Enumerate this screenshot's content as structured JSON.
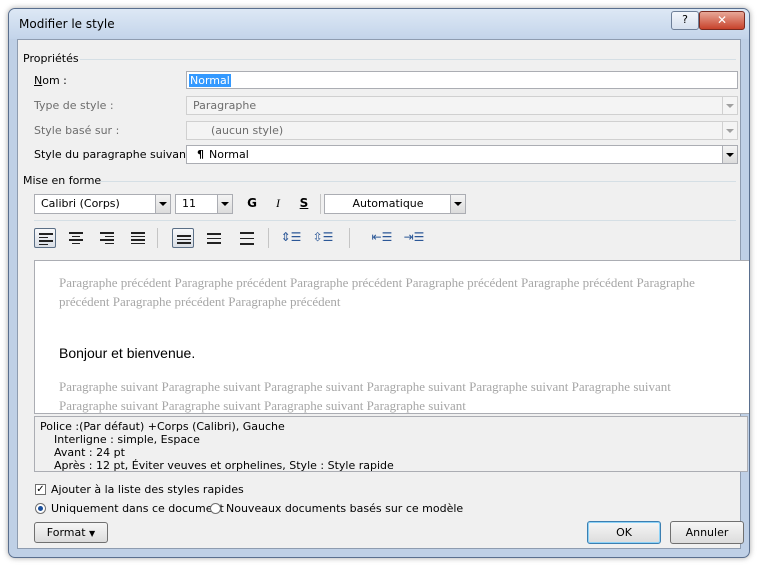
{
  "window": {
    "title": "Modifier le style",
    "help_label": "?",
    "close_label": "✕"
  },
  "properties": {
    "section_label": "Propriétés",
    "name_label": "Nom :",
    "name_value": "Normal",
    "style_type_label": "Type de style :",
    "style_type_value": "Paragraphe",
    "based_on_label": "Style basé sur :",
    "based_on_value": "(aucun style)",
    "next_style_label": "Style du paragraphe suivant :",
    "next_style_icon": "¶",
    "next_style_value": "Normal"
  },
  "formatting": {
    "section_label": "Mise en forme",
    "font": "Calibri (Corps)",
    "size": "11",
    "bold_label": "G",
    "italic_label": "I",
    "underline_label": "S",
    "color": "Automatique"
  },
  "preview": {
    "previous": "Paragraphe précédent Paragraphe précédent Paragraphe précédent Paragraphe précédent Paragraphe précédent Paragraphe précédent Paragraphe précédent Paragraphe précédent",
    "sample": "Bonjour et bienvenue.",
    "next": "Paragraphe suivant Paragraphe suivant Paragraphe suivant Paragraphe suivant Paragraphe suivant Paragraphe suivant Paragraphe suivant Paragraphe suivant Paragraphe suivant Paragraphe suivant"
  },
  "description": {
    "line1": "Police :(Par défaut) +Corps (Calibri), Gauche",
    "line2": "Interligne : simple, Espace",
    "line3": "Avant : 24 pt",
    "line4": "Après : 12 pt, Éviter veuves et orphelines, Style : Style rapide"
  },
  "options": {
    "add_quick_styles": "Ajouter à la liste des styles rapides",
    "only_this_document": "Uniquement dans ce document",
    "new_documents": "Nouveaux documents basés sur ce modèle"
  },
  "buttons": {
    "format": "Format",
    "ok": "OK",
    "cancel": "Annuler"
  }
}
